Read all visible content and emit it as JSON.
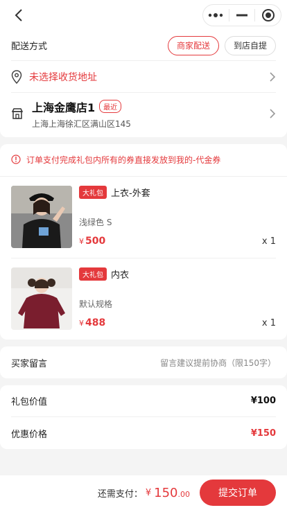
{
  "colors": {
    "accent": "#e4393c",
    "background": "#f4f4f4"
  },
  "icons": {
    "back": "chevron-left-icon",
    "more": "more-dots-icon",
    "minimize": "minus-icon",
    "close": "target-circle-icon",
    "location": "location-pin-icon",
    "store": "store-icon",
    "arrow": "chevron-right-icon",
    "notice": "info-circle-icon"
  },
  "delivery": {
    "label": "配送方式",
    "options": [
      "商家配送",
      "到店自提"
    ],
    "selected": "商家配送"
  },
  "address": {
    "placeholder": "未选择收货地址"
  },
  "store": {
    "name": "上海金鹰店1",
    "tag": "最近",
    "address": "上海上海徐汇区满山区145"
  },
  "notice": "订单支付完成礼包内所有的券直接发放到我的-代金券",
  "goods": [
    {
      "badge": "大礼包",
      "title": "上衣-外套",
      "spec": "浅绿色 S",
      "price_symbol": "¥",
      "price": "500",
      "qty": "x 1"
    },
    {
      "badge": "大礼包",
      "title": "内衣",
      "spec": "默认规格",
      "price_symbol": "¥",
      "price": "488",
      "qty": "x 1"
    }
  ],
  "message": {
    "label": "买家留言",
    "placeholder": "留言建议提前协商（限150字）"
  },
  "summary": {
    "gift_value_label": "礼包价值",
    "gift_value": "¥100",
    "discount_label": "优惠价格",
    "discount_value": "¥150"
  },
  "footer": {
    "pay_label": "还需支付：",
    "currency": "¥",
    "amount_int": "150",
    "amount_dec": ".00",
    "submit_label": "提交订单"
  }
}
